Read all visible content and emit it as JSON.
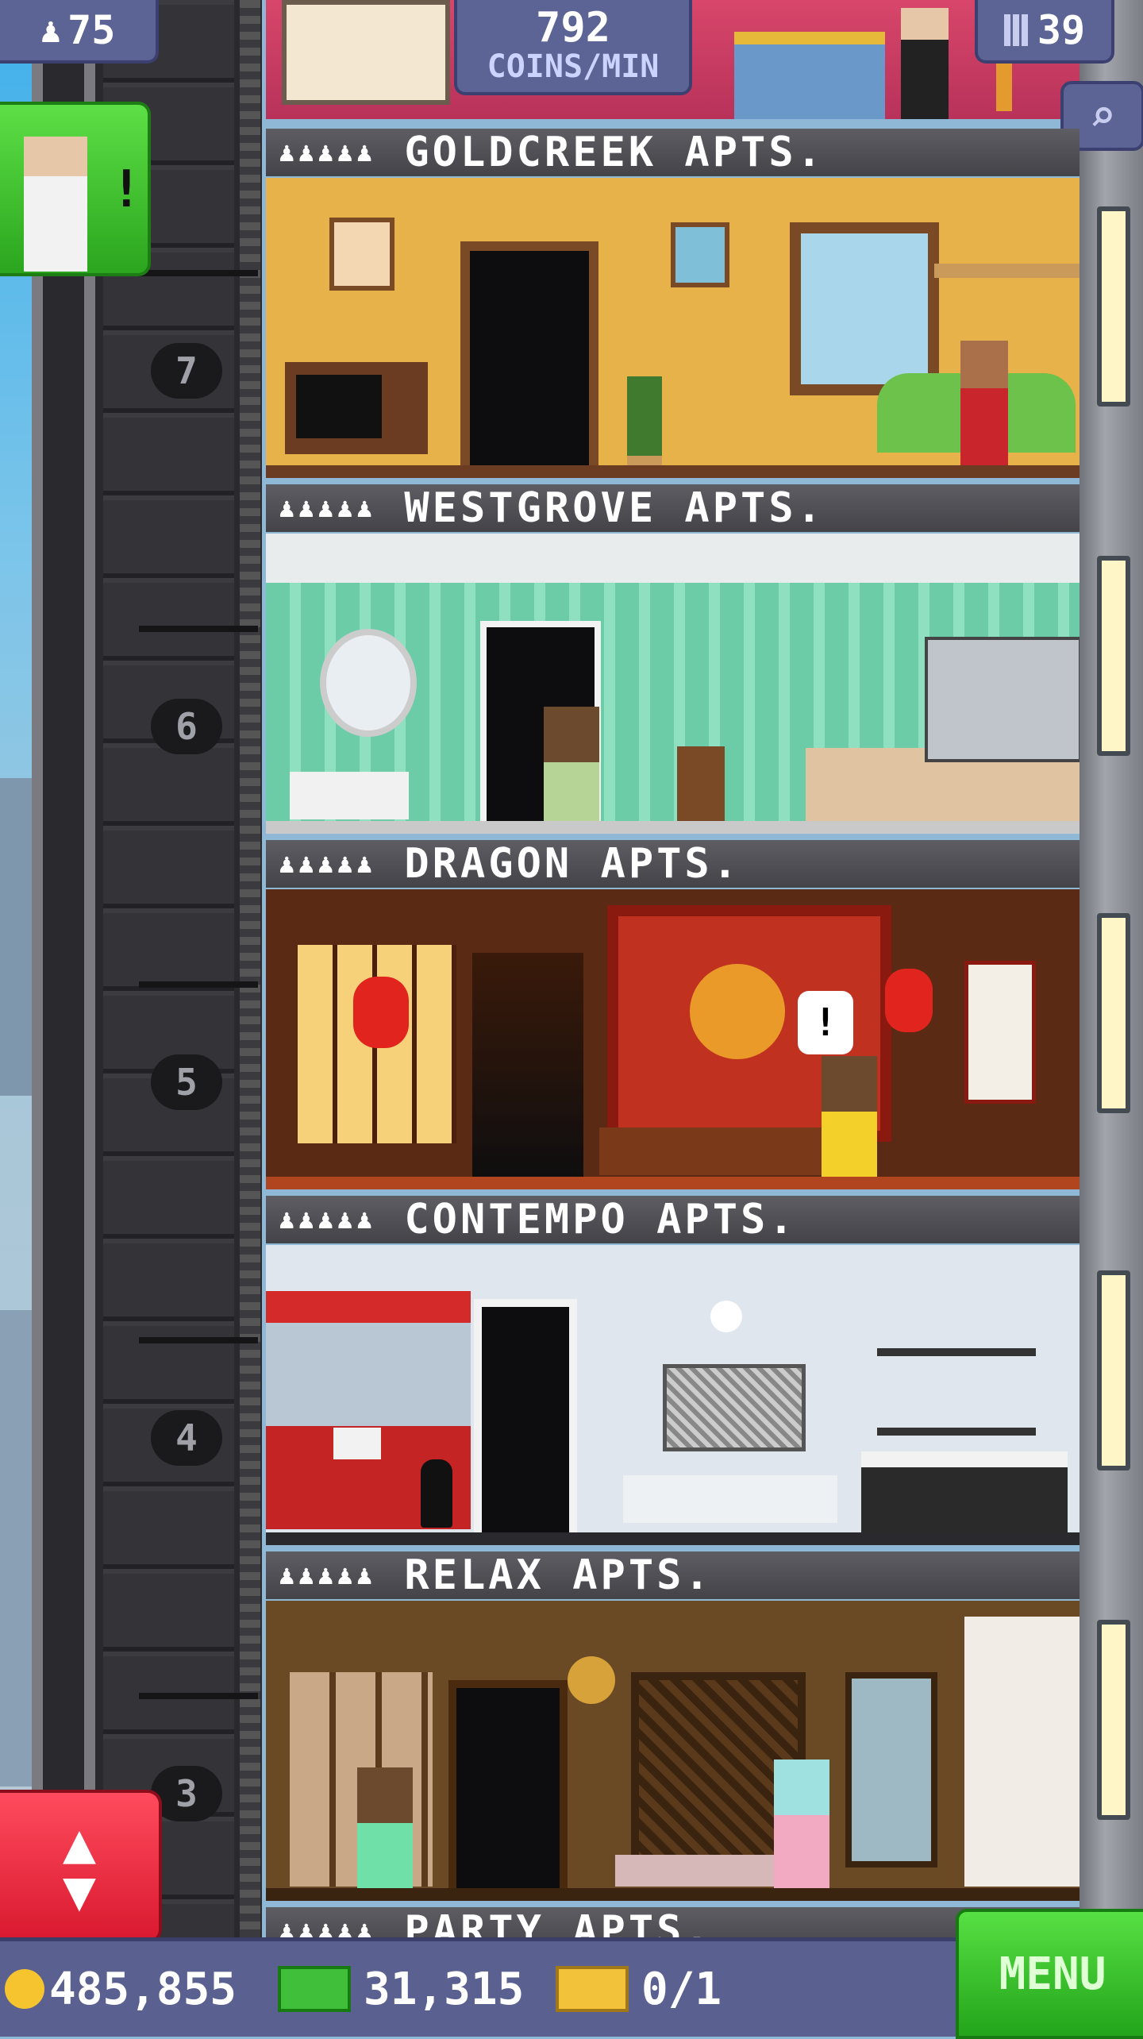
{
  "hud": {
    "population": "75",
    "coins_per_min_value": "792",
    "coins_per_min_label": "COINS/MIN",
    "floors": "39"
  },
  "shaft": {
    "floor_numbers": [
      "7",
      "6",
      "5",
      "4",
      "3"
    ]
  },
  "floors": [
    {
      "name": "GOLDCREEK APTS.",
      "people": "♟♟♟♟♟"
    },
    {
      "name": "WESTGROVE APTS.",
      "people": "♟♟♟♟♟"
    },
    {
      "name": "DRAGON APTS.",
      "people": "♟♟♟♟♟"
    },
    {
      "name": "CONTEMPO APTS.",
      "people": "♟♟♟♟♟"
    },
    {
      "name": "RELAX APTS.",
      "people": "♟♟♟♟♟"
    },
    {
      "name": "PARTY APTS.",
      "people": "♟♟♟♟♟"
    }
  ],
  "bottom": {
    "coins": "485,855",
    "bux": "31,315",
    "tickets": "0/1",
    "menu_label": "MENU"
  },
  "colors": {
    "hud_bg": "#5b6494",
    "menu_green": "#2ba51e",
    "elevator_red": "#d9192f",
    "goldcreek_wall": "#e8b24a",
    "westgrove_wall": "#7fd6b8",
    "dragon_wall": "#5a2a14",
    "contempo_wall": "#dfe6ee",
    "relax_wall": "#6a4a24"
  }
}
